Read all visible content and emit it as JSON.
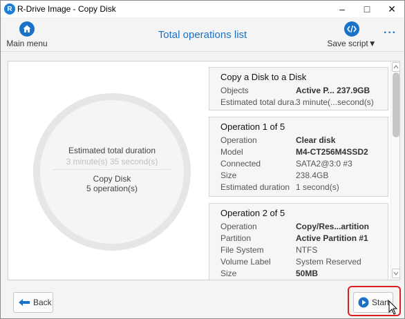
{
  "window": {
    "title": "R-Drive Image - Copy Disk",
    "minimize": "–",
    "maximize": "□",
    "close": "✕"
  },
  "header": {
    "main_menu_label": "Main menu",
    "title": "Total operations list",
    "save_script_label": "Save script▼",
    "more": "···"
  },
  "summary": {
    "duration_label": "Estimated total duration",
    "duration_value": "3 minute(s) 35 second(s)",
    "task_name": "Copy Disk",
    "task_count": "5 operation(s)"
  },
  "cards": [
    {
      "title": "Copy a Disk to a Disk",
      "rows": [
        {
          "k": "Objects",
          "v": "Active P... 237.9GB",
          "bold": true
        },
        {
          "k": "Estimated total dura...",
          "v": "3 minute(...second(s)",
          "bold": false
        }
      ]
    },
    {
      "title": "Operation 1 of 5",
      "rows": [
        {
          "k": "Operation",
          "v": "Clear disk",
          "bold": true
        },
        {
          "k": "Model",
          "v": "M4-CT256M4SSD2",
          "bold": true
        },
        {
          "k": "Connected",
          "v": "SATA2@3:0 #3",
          "bold": false
        },
        {
          "k": "Size",
          "v": "238.4GB",
          "bold": false
        },
        {
          "k": "Estimated duration",
          "v": "1 second(s)",
          "bold": false
        }
      ]
    },
    {
      "title": "Operation 2 of 5",
      "rows": [
        {
          "k": "Operation",
          "v": "Copy/Res...artition",
          "bold": true
        },
        {
          "k": "Partition",
          "v": "Active Partition #1",
          "bold": true
        },
        {
          "k": "File System",
          "v": "NTFS",
          "bold": false
        },
        {
          "k": "Volume Label",
          "v": "System Reserved",
          "bold": false
        },
        {
          "k": "Size",
          "v": "50MB",
          "bold": true
        }
      ]
    }
  ],
  "footer": {
    "back_label": "Back",
    "start_label": "Start"
  },
  "colors": {
    "accent": "#1a72c8",
    "highlight": "#d9201f"
  }
}
